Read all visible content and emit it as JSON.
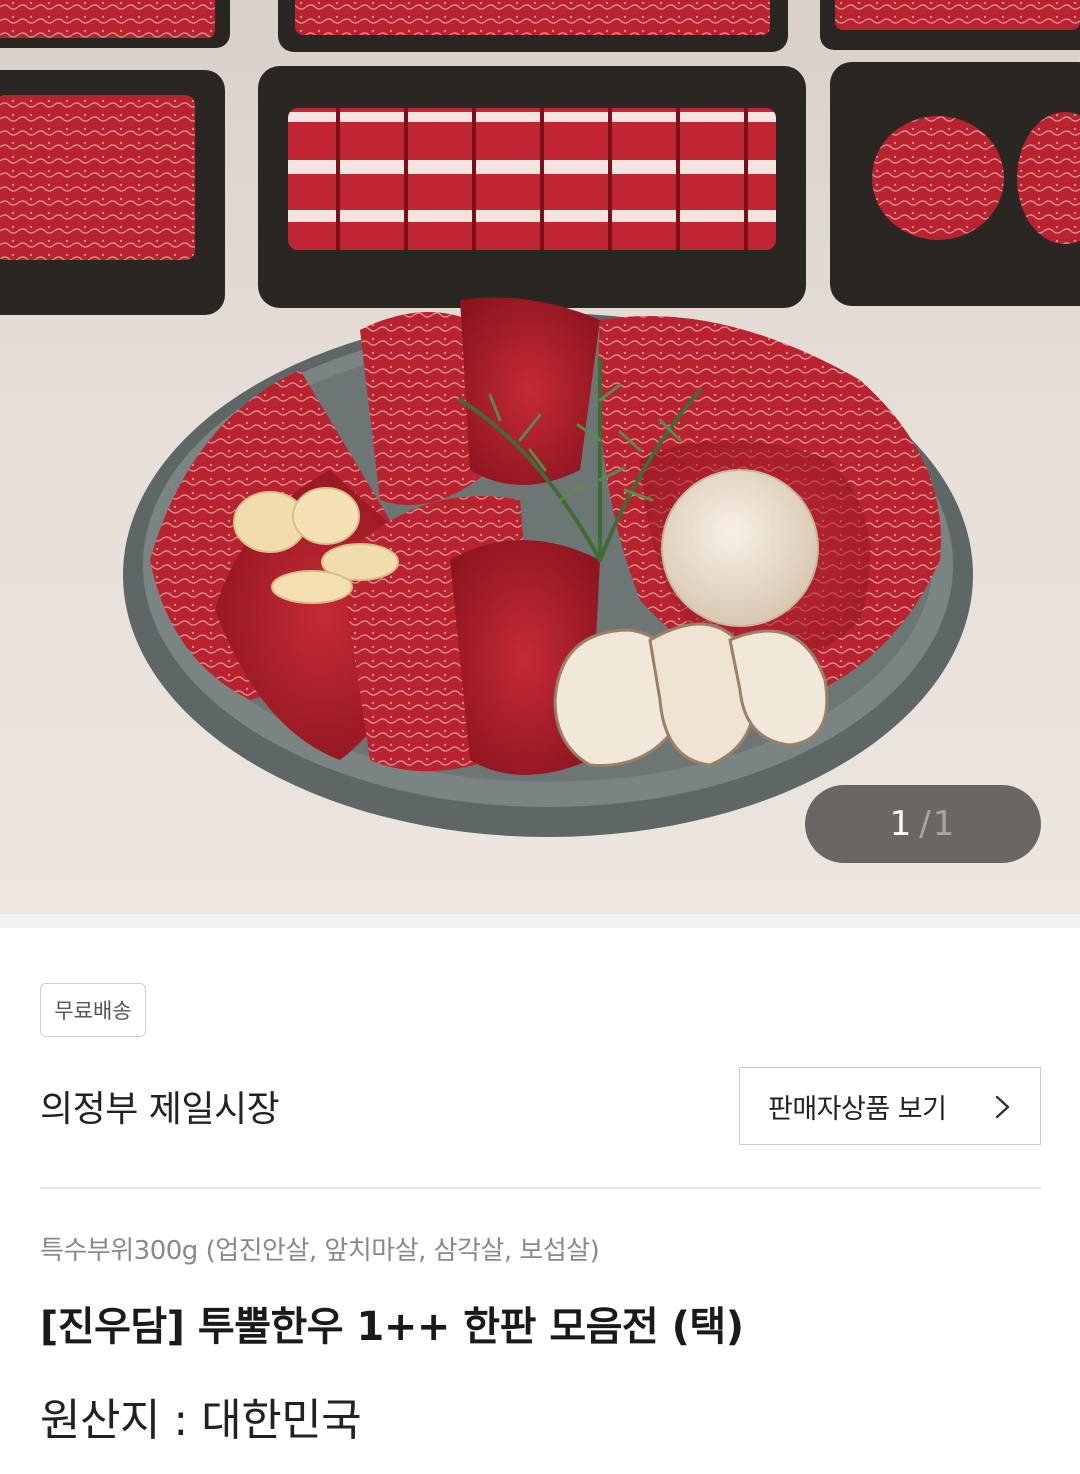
{
  "gallery": {
    "image_alt": "Korean hanwoo beef platter with trays of sliced beef, rosemary, garlic and mushrooms",
    "counter": {
      "current": "1",
      "separator": "/",
      "total": "1"
    }
  },
  "product": {
    "badge": "무료배송",
    "seller_name": "의정부 제일시장",
    "seller_button_label": "판매자상품 보기",
    "subtitle": "특수부위300g (업진안살, 앞치마살, 삼각살, 보섭살)",
    "title": "[진우담] 투뿔한우 1++ 한판 모음전 (택)",
    "origin": "원산지 : 대한민국"
  },
  "colors": {
    "meat": "#b3202c",
    "tray": "#2a2622",
    "plate": "#6f7a78",
    "counter_bg": "#46423e"
  }
}
